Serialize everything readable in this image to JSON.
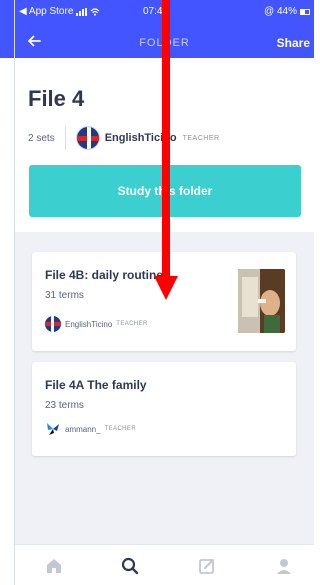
{
  "status_bar": {
    "back_app": "◀ App Store",
    "time": "07:43",
    "battery": "@ 44%"
  },
  "nav": {
    "title": "FOLDER",
    "share_label": "Share"
  },
  "folder": {
    "title": "File 4",
    "sets_count": "2 sets",
    "owner_name": "EnglishTicino",
    "owner_role": "TEACHER",
    "study_button_label": "Study this folder"
  },
  "sets": [
    {
      "title": "File 4B: daily routine",
      "terms": "31 terms",
      "author": "EnglishTicino",
      "role": "TEACHER",
      "has_thumbnail": true
    },
    {
      "title": "File 4A The family",
      "terms": "23 terms",
      "author": "ammann_",
      "role": "TEACHER",
      "has_thumbnail": false
    }
  ],
  "tabs": [
    {
      "icon": "home-icon",
      "active": false
    },
    {
      "icon": "search-icon",
      "active": true
    },
    {
      "icon": "create-icon",
      "active": false
    },
    {
      "icon": "profile-icon",
      "active": false
    }
  ],
  "colors": {
    "brand_blue": "#4255ff",
    "study_teal": "#3ccfcf",
    "list_background": "#f0f1f6",
    "annotation_arrow": "#ff0000"
  }
}
